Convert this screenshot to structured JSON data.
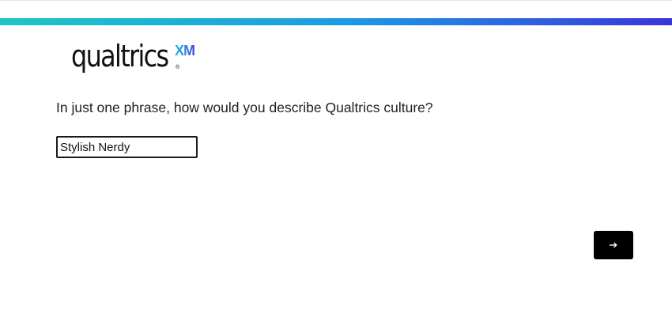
{
  "progress": {
    "percent": 100,
    "gradient": [
      "#1fc5c3",
      "#1a9ee3",
      "#3b34d9"
    ]
  },
  "logo": {
    "word": "qualtrics",
    "registered": "®",
    "suffix": "XM"
  },
  "question": {
    "text": "In just one phrase, how would you describe Qualtrics culture?"
  },
  "answer": {
    "value": "Stylish Nerdy"
  },
  "navigation": {
    "next_icon": "arrow-right-icon",
    "button_color": "#000000"
  }
}
